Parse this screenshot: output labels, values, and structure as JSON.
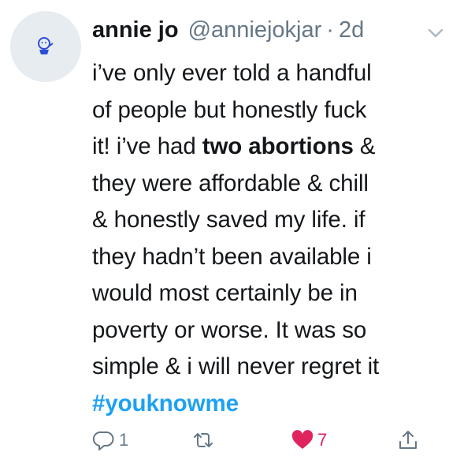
{
  "tweet": {
    "author_name": "annie jo",
    "handle": "@anniejokjar",
    "separator": "·",
    "time": "2d",
    "lines": [
      {
        "pre": "i’ve only ever told a handful",
        "bold": "",
        "post": ""
      },
      {
        "pre": "of people but honestly fuck",
        "bold": "",
        "post": ""
      },
      {
        "pre": "it! i’ve had ",
        "bold": "two abortions",
        "post": " &"
      },
      {
        "pre": "they were affordable & chill",
        "bold": "",
        "post": ""
      },
      {
        "pre": "& honestly saved my life. if",
        "bold": "",
        "post": ""
      },
      {
        "pre": "they hadn’t been available i",
        "bold": "",
        "post": ""
      },
      {
        "pre": "would most certainly be in",
        "bold": "",
        "post": ""
      },
      {
        "pre": "poverty or worse. It was so",
        "bold": "",
        "post": ""
      },
      {
        "pre": "simple & i will never regret it",
        "bold": "",
        "post": ""
      }
    ],
    "hashtag": "#youknowme",
    "reply_count": "1",
    "like_count": "7",
    "like_color": "#e0245e",
    "hashtag_color": "#1da1f2",
    "icons": {
      "reply": "reply-icon",
      "retweet": "retweet-icon",
      "like": "heart-icon",
      "share": "share-icon",
      "more": "chevron-down-icon"
    }
  }
}
